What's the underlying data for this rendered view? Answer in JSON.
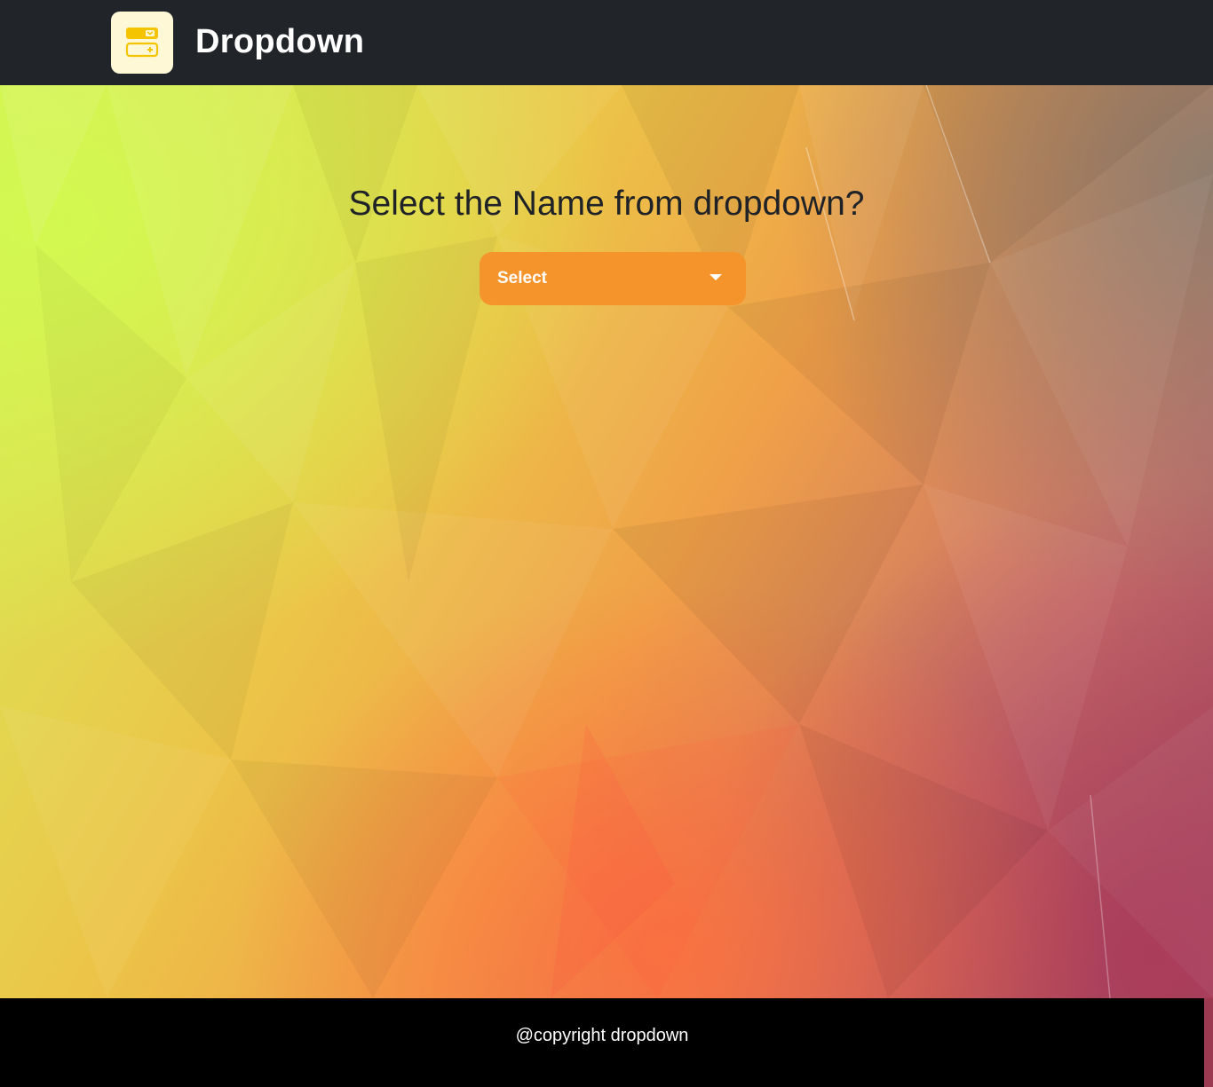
{
  "header": {
    "brand_title": "Dropdown",
    "logo_icon": "dropdown-icon"
  },
  "main": {
    "question": "Select the Name from dropdown?",
    "dropdown": {
      "selected_label": "Select",
      "icon": "caret-down-icon"
    }
  },
  "footer": {
    "text": "@copyright dropdown"
  },
  "colors": {
    "navbar_bg": "#212429",
    "logo_tile_bg": "#fff8d6",
    "logo_icon": "#f5c400",
    "dropdown_bg": "#f6942c",
    "footer_bg": "#000000",
    "question_text": "#1f2328"
  }
}
